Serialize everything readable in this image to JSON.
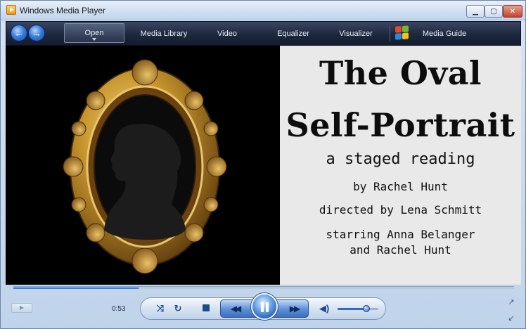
{
  "window": {
    "title": "Windows Media Player",
    "controls": {
      "minimize": "▁",
      "maximize": "▢",
      "close": "✕"
    }
  },
  "nav": {
    "back_icon": "back-arrow-icon",
    "forward_icon": "forward-arrow-icon",
    "tabs": [
      {
        "label": "Open",
        "active": true
      },
      {
        "label": "Media Library",
        "active": false
      },
      {
        "label": "Video",
        "active": false
      },
      {
        "label": "Equalizer",
        "active": false
      },
      {
        "label": "Visualizer",
        "active": false
      },
      {
        "label": "Media Guide",
        "active": false
      }
    ]
  },
  "video": {
    "title_line1": "The Oval",
    "title_line2": "Self-Portrait",
    "subtitle": "a staged reading",
    "author": "by Rachel Hunt",
    "director": "directed by Lena Schmitt",
    "starring_line1": "starring Anna Belanger",
    "starring_line2": "and Rachel Hunt"
  },
  "player": {
    "elapsed": "0:53",
    "seek_progress": 0.25,
    "volume_level": 0.7,
    "shuffle_glyph": "⤨",
    "repeat_glyph": "↻",
    "prev_glyph": "◀◀",
    "next_glyph": "▶▶",
    "volume_glyph": "◀)"
  },
  "colors": {
    "nav_bg": "#1f2a40",
    "accent": "#2e6fd2",
    "frame_gold": "#c8962e"
  }
}
